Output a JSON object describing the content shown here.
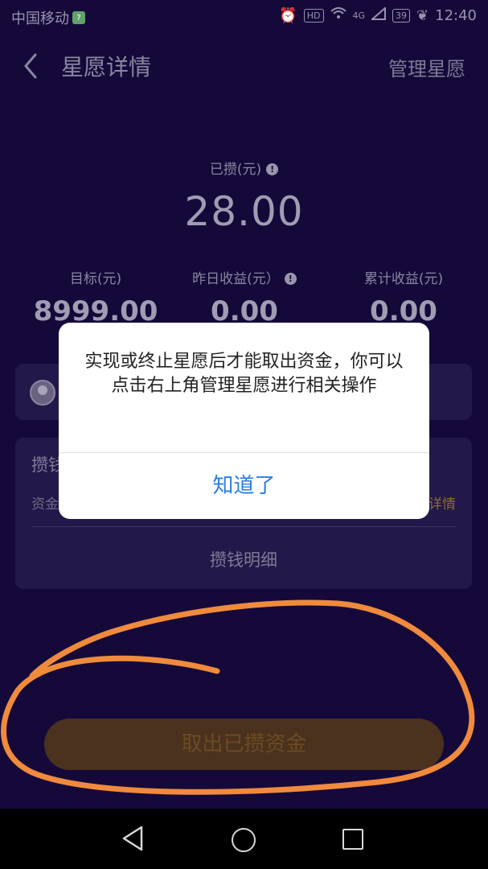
{
  "status_bar": {
    "carrier": "中国移动",
    "carrier_badge": "?",
    "hd": "HD",
    "network": "4G",
    "battery": "39",
    "time": "12:40"
  },
  "header": {
    "title": "星愿详情",
    "manage": "管理星愿"
  },
  "summary": {
    "saved_label": "已攒(元)",
    "saved_value": "28.00",
    "stats": [
      {
        "label": "目标(元)",
        "value": "8999.00"
      },
      {
        "label": "昨日收益(元）",
        "value": "0.00"
      },
      {
        "label": "累计收益(元)",
        "value": "0.00"
      }
    ]
  },
  "savings_card": {
    "title_partial": "攒钱",
    "row_label_partial": "资金",
    "detail_partial": "详情",
    "detail_link": "攒钱明细"
  },
  "withdraw_button": "取出已攒资金",
  "dialog": {
    "message": "实现或终止星愿后才能取出资金，你可以点击右上角管理星愿进行相关操作",
    "confirm": "知道了"
  },
  "colors": {
    "background": "#15093a",
    "card": "#23184a",
    "dialog_button": "#2a7de1",
    "annotation": "#f08a3c"
  },
  "icons": [
    "back-chevron-icon",
    "info-icon",
    "avatar-icon",
    "nav-back-icon",
    "nav-home-icon",
    "nav-recent-icon"
  ]
}
